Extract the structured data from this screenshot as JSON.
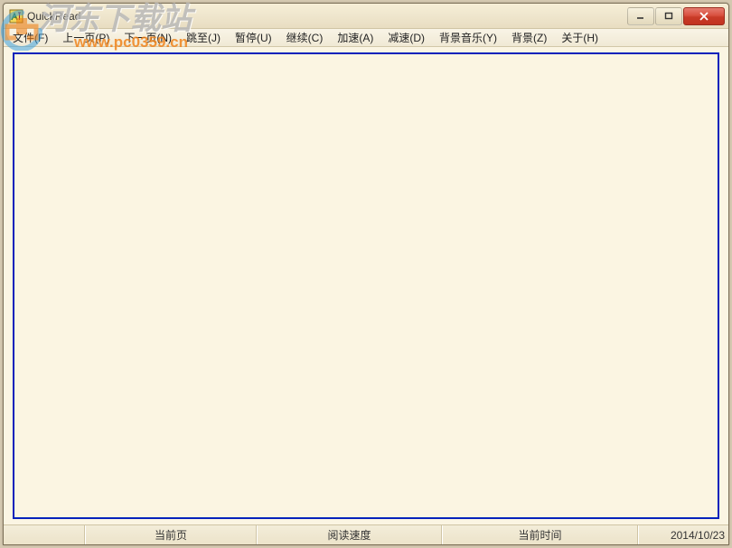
{
  "window": {
    "title": "QuickRead"
  },
  "menu": {
    "file": "文件(F)",
    "prev": "上一页(P)",
    "next": "下一页(N)",
    "jump": "跳至(J)",
    "pause": "暂停(U)",
    "continue": "继续(C)",
    "speedup": "加速(A)",
    "slowdown": "减速(D)",
    "bgmusic": "背景音乐(Y)",
    "bg": "背景(Z)",
    "about": "关于(H)"
  },
  "status": {
    "current_page_label": "当前页",
    "read_speed_label": "阅读速度",
    "current_time_label": "当前时间",
    "date": "2014/10/23"
  },
  "watermark": {
    "cn": "河东下载站",
    "url": "www.pc0359.cn"
  }
}
